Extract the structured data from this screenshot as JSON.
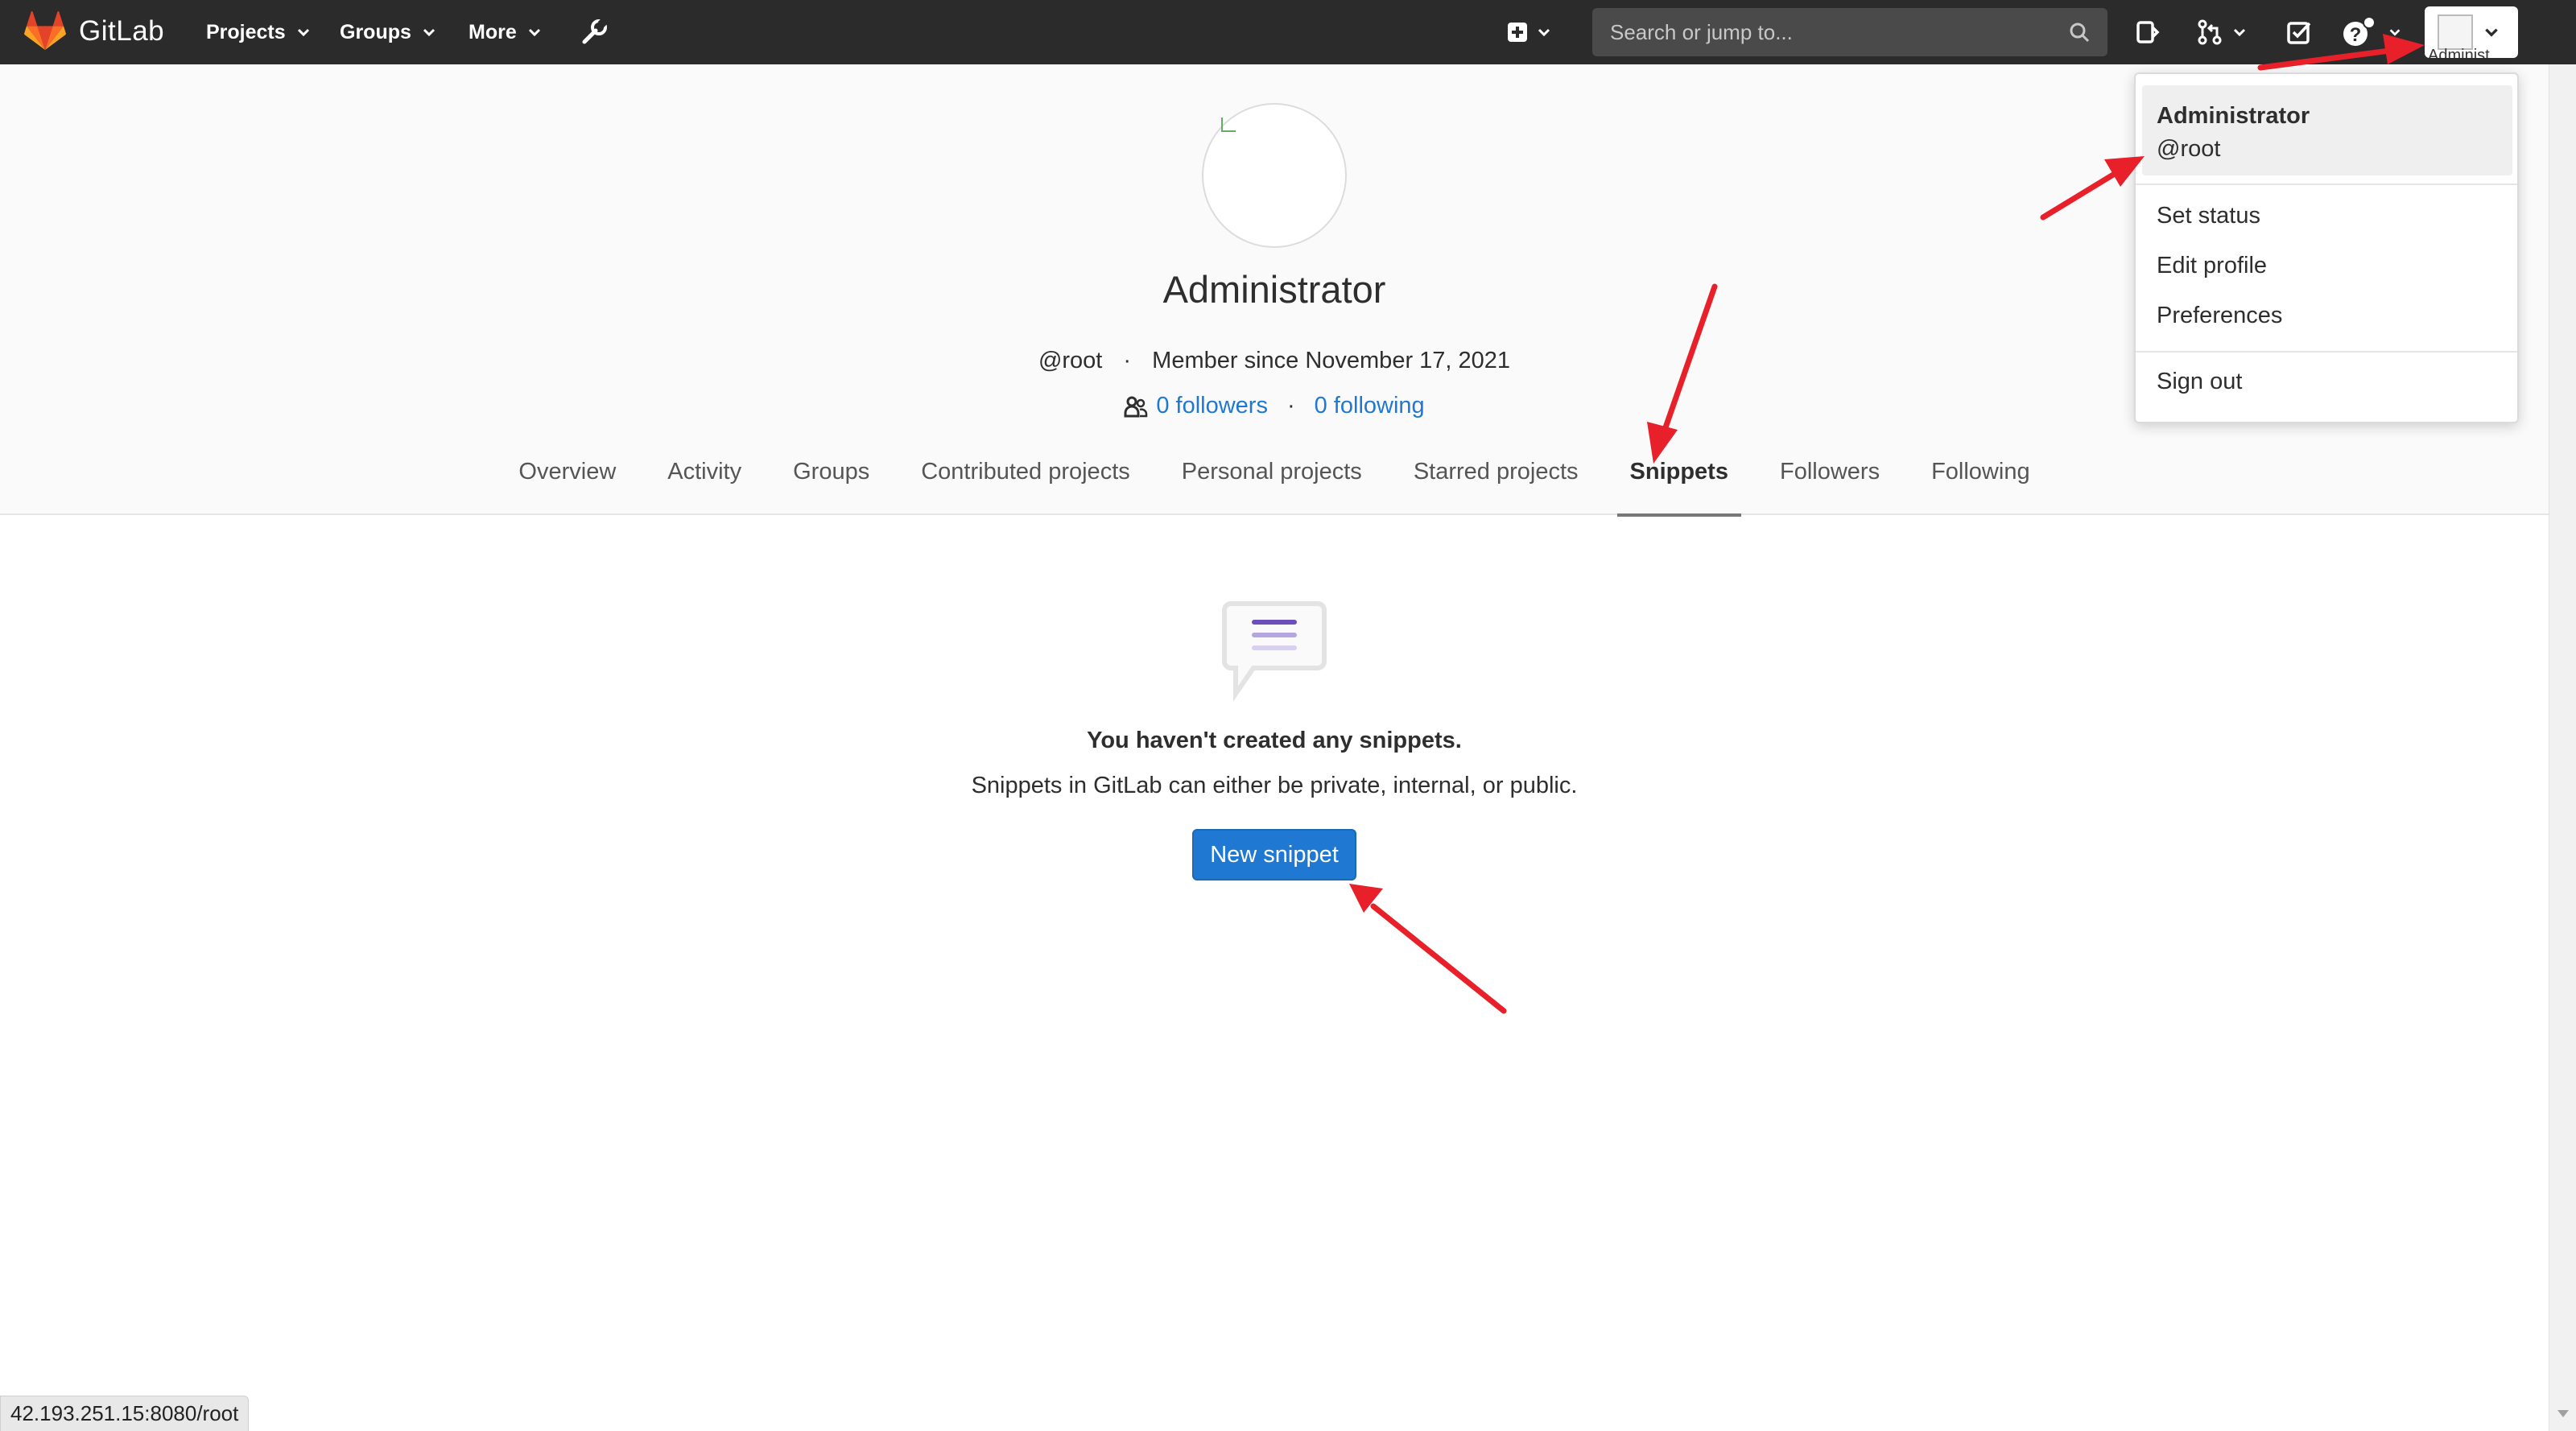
{
  "nav": {
    "brand": "GitLab",
    "projects": "Projects",
    "groups": "Groups",
    "more": "More",
    "search_placeholder": "Search or jump to...",
    "user_label_cut": "Administ",
    "icons": [
      "gitlab-logo-icon",
      "admin-wrench-icon",
      "plus-square-icon",
      "issues-icon",
      "merge-request-icon",
      "todo-check-icon",
      "help-icon"
    ]
  },
  "profile": {
    "name": "Administrator",
    "username": "@root",
    "dot": "·",
    "member_since": "Member since November 17, 2021",
    "followers": "0 followers",
    "following": "0 following"
  },
  "tabs": [
    {
      "label": "Overview",
      "active": false
    },
    {
      "label": "Activity",
      "active": false
    },
    {
      "label": "Groups",
      "active": false
    },
    {
      "label": "Contributed projects",
      "active": false
    },
    {
      "label": "Personal projects",
      "active": false
    },
    {
      "label": "Starred projects",
      "active": false
    },
    {
      "label": "Snippets",
      "active": true
    },
    {
      "label": "Followers",
      "active": false
    },
    {
      "label": "Following",
      "active": false
    }
  ],
  "empty_state": {
    "title": "You haven't created any snippets.",
    "description": "Snippets in GitLab can either be private, internal, or public.",
    "button": "New snippet"
  },
  "dropdown": {
    "name": "Administrator",
    "username": "@root",
    "set_status": "Set status",
    "edit_profile": "Edit profile",
    "preferences": "Preferences",
    "sign_out": "Sign out"
  },
  "status_bar": {
    "url": "42.193.251.15:8080/root"
  },
  "colors": {
    "nav_bg": "#2b2b2b",
    "link": "#1f78d1",
    "primary_button": "#1f78d1",
    "annotation": "#e8202a"
  }
}
